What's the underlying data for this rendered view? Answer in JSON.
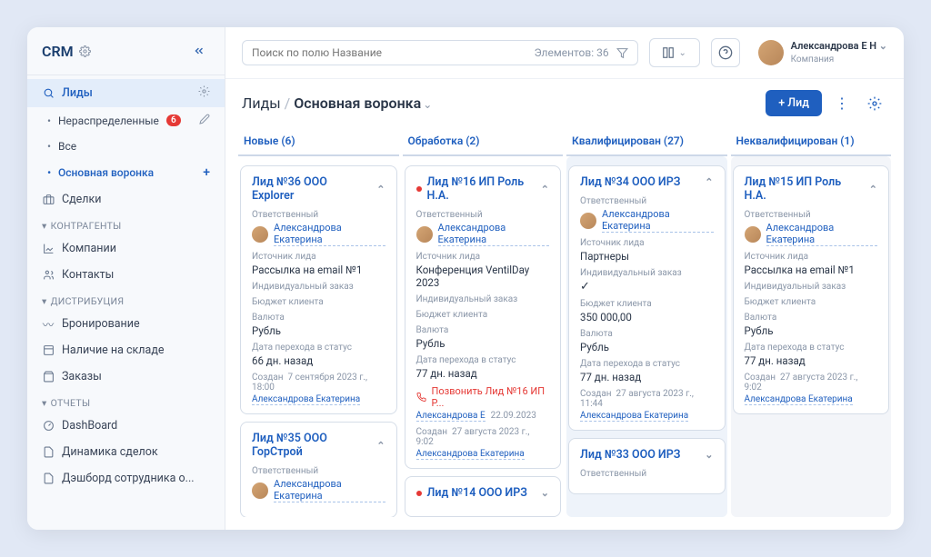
{
  "brand": "CRM",
  "sidebar": {
    "leads": "Лиды",
    "sub_unassigned": "Нераспределенные",
    "sub_unassigned_count": "6",
    "sub_all": "Все",
    "sub_funnel": "Основная воронка",
    "deals": "Сделки",
    "sec_contractors": "КОНТРАГЕНТЫ",
    "companies": "Компании",
    "contacts": "Контакты",
    "sec_dist": "ДИСТРИБУЦИЯ",
    "booking": "Бронирование",
    "stock": "Наличие на складе",
    "orders": "Заказы",
    "sec_reports": "ОТЧЕТЫ",
    "dashboard": "DashBoard",
    "deal_dyn": "Динамика сделок",
    "emp_dash": "Дэшборд сотрудника о..."
  },
  "search": {
    "placeholder": "Поиск по полю Название",
    "count": "Элементов: 36"
  },
  "user": {
    "name": "Александрова Е Н",
    "company": "Компания"
  },
  "breadcrumb": {
    "root": "Лиды",
    "current": "Основная воронка"
  },
  "add_lead": "+ Лид",
  "labels": {
    "responsible": "Ответственный",
    "assignee": "Александрова Екатерина",
    "source": "Источник лида",
    "custom": "Индивидуальный заказ",
    "budget": "Бюджет клиента",
    "currency": "Валюта",
    "rub": "Рубль",
    "status_date": "Дата перехода в статус",
    "created": "Создан"
  },
  "cols": [
    {
      "title": "Новые (6)"
    },
    {
      "title": "Обработка (2)"
    },
    {
      "title": "Квалифицирован (27)"
    },
    {
      "title": "Неквалифицирован (1)"
    }
  ],
  "c1": {
    "t1": "Лид №36 ООО Explorer",
    "src1": "Рассылка на email №1",
    "days1": "66 дн. назад",
    "created1": "7 сентября 2023 г., 18:00",
    "t2": "Лид №35 ООО ГорСтрой"
  },
  "c2": {
    "t1": "Лид №16 ИП Роль Н.А.",
    "src1": "Конференция VentilDay 2023",
    "days1": "77 дн. назад",
    "call": "Позвонить Лид №16 ИП Р...",
    "call_who": "Александрова Е",
    "call_date": "22.09.2023",
    "created1": "27 августа 2023 г., 9:02",
    "t2": "Лид №14 ООО ИРЗ"
  },
  "c3": {
    "t1": "Лид №34 ООО ИРЗ",
    "src1": "Партнеры",
    "budget": "350 000,00",
    "days1": "77 дн. назад",
    "created1": "27 августа 2023 г., 11:44",
    "t2": "Лид №33 ООО ИРЗ"
  },
  "c4": {
    "t1": "Лид №15 ИП Роль Н.А.",
    "src1": "Рассылка на email №1",
    "days1": "77 дн. назад",
    "created1": "27 августа 2023 г., 9:02"
  }
}
